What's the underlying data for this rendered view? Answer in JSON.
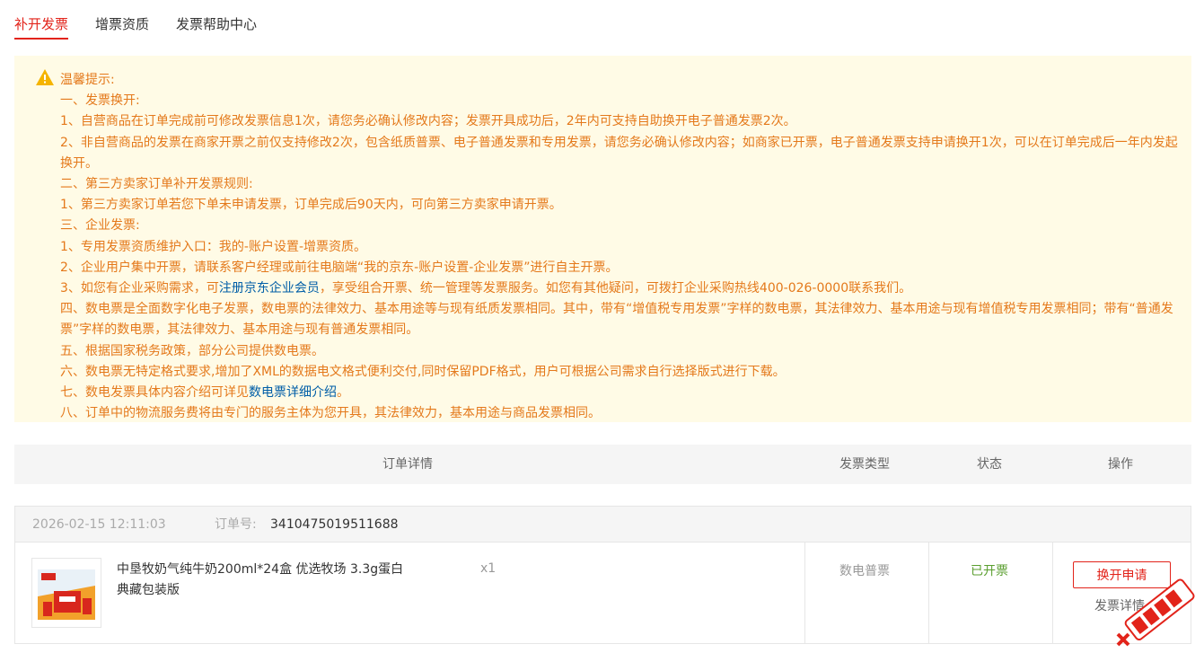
{
  "tabs": [
    "补开发票",
    "增票资质",
    "发票帮助中心"
  ],
  "notice": {
    "title": "温馨提示:",
    "lines": [
      "一、发票换开:",
      "1、自营商品在订单完成前可修改发票信息1次，请您务必确认修改内容；发票开具成功后，2年内可支持自助换开电子普通发票2次。",
      "2、非自营商品的发票在商家开票之前仅支持修改2次，包含纸质普票、电子普通发票和专用发票，请您务必确认修改内容；如商家已开票，电子普通发票支持申请换开1次，可以在订单完成后一年内发起换开。",
      "二、第三方卖家订单补开发票规则:",
      "1、第三方卖家订单若您下单未申请发票，订单完成后90天内，可向第三方卖家申请开票。",
      "三、企业发票:",
      "1、专用发票资质维护入口：我的-账户设置-增票资质。",
      "2、企业用户集中开票，请联系客户经理或前往电脑端“我的京东-账户设置-企业发票”进行自主开票。"
    ],
    "line3_pre": "3、如您有企业采购需求，可",
    "line3_link": "注册京东企业会员",
    "line3_post": "，享受组合开票、统一管理等发票服务。如您有其他疑问，可拨打企业采购热线400-026-0000联系我们。",
    "lines2": [
      "四、数电票是全面数字化电子发票，数电票的法律效力、基本用途等与现有纸质发票相同。其中，带有“增值税专用发票”字样的数电票，其法律效力、基本用途与现有增值税专用发票相同；带有“普通发票”字样的数电票，其法律效力、基本用途与现有普通发票相同。",
      "五、根据国家税务政策，部分公司提供数电票。",
      "六、数电票无特定格式要求,增加了XML的数据电文格式便利交付,同时保留PDF格式，用户可根据公司需求自行选择版式进行下载。"
    ],
    "line7_pre": "七、数电发票具体内容介绍可详见",
    "line7_link": "数电票详细介绍",
    "line7_post": "。",
    "line8": "八、订单中的物流服务费将由专门的服务主体为您开具，其法律效力，基本用途与商品发票相同。"
  },
  "table_header": {
    "order_detail": "订单详情",
    "invoice_type": "发票类型",
    "status": "状态",
    "action": "操作"
  },
  "order": {
    "datetime": "2026-02-15 12:11:03",
    "order_label": "订单号:",
    "order_number": "3410475019511688",
    "product_name": "中垦牧奶气纯牛奶200ml*24盒 优选牧场 3.3g蛋白 典藏包装版",
    "quantity": "x1",
    "invoice_type": "数电普票",
    "status": "已开票",
    "reissue_button": "换开申请",
    "detail_link": "发票详情"
  },
  "colors": {
    "accent": "#e2231a",
    "notice_text": "#e4791b",
    "notice_bg": "#fffbe6",
    "status_ok": "#5a9e2f",
    "link": "#005ea7"
  }
}
